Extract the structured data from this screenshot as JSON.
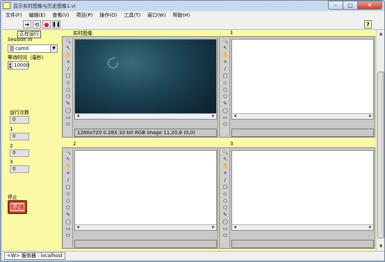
{
  "window": {
    "title": "显示实时图像与历史图像1.vi",
    "buttons": [
      "–",
      "□",
      "✕"
    ]
  },
  "menu": [
    "文件(F)",
    "编辑(E)",
    "查看(V)",
    "项目(P)",
    "操作(O)",
    "工具(T)",
    "窗口(W)",
    "帮助(H)"
  ],
  "toolbar": {
    "run_icon": "run-arrow-icon",
    "run_continuous_icon": "run-continuously-icon",
    "abort_icon": "abort-execution-icon",
    "pause_icon": "pause-icon",
    "help_label": "?",
    "tooltip": "正在运行"
  },
  "controls": {
    "session_label": "Session In",
    "session_value": "cam0",
    "wait_label": "等待时间（毫秒）",
    "wait_value": "10000",
    "run_count_label": "运行次数",
    "run_count_value": "0",
    "ind1_label": "1",
    "ind1_value": "0",
    "ind2_label": "2",
    "ind2_value": "0",
    "ind3_label": "3",
    "ind3_value": "0",
    "stop_label": "停止",
    "stop_button": "停止"
  },
  "displays": [
    {
      "title": "实时图像",
      "info": "1280x720 0.28X 32-bit RGB image 11,20,8      (0,0)"
    },
    {
      "title": "1",
      "info": ""
    },
    {
      "title": "2",
      "info": ""
    },
    {
      "title": "3",
      "info": ""
    }
  ],
  "palette_tools": [
    "🔍",
    "↖",
    "✋",
    "+",
    "/",
    "□",
    "◇",
    "○",
    "⬠",
    "✎",
    "◯",
    "▭",
    "⬭"
  ],
  "status": {
    "text": "<W>  服务器 : localhost"
  }
}
